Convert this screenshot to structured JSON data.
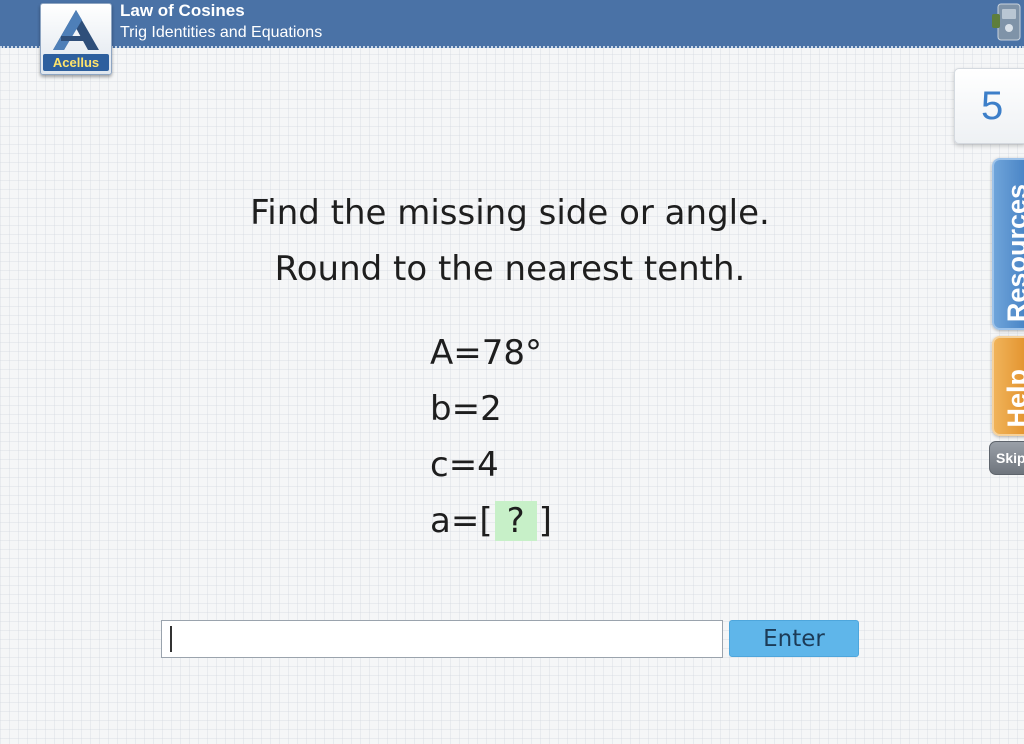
{
  "header": {
    "logo_text": "Acellus",
    "lesson_title": "Law of Cosines",
    "course_subtitle": "Trig Identities and Equations"
  },
  "sidebar": {
    "question_number": "5",
    "resources_label": "Resources",
    "help_label": "Help",
    "skip_label": "Skip"
  },
  "question": {
    "instruction_line1": "Find the missing side or angle.",
    "instruction_line2": "Round to the nearest tenth.",
    "given": [
      {
        "label": "A=78°"
      },
      {
        "label": "b=2"
      },
      {
        "label": "c=4"
      }
    ],
    "unknown_prefix": "a=[",
    "unknown_placeholder": "?",
    "unknown_suffix": "]"
  },
  "answer": {
    "input_value": "",
    "enter_label": "Enter"
  },
  "colors": {
    "header_bg": "#4a72a6",
    "accent_blue": "#3d7fc9",
    "enter_button": "#5fb6ea",
    "help_orange": "#e08c24",
    "unknown_highlight": "#c7f0c8"
  },
  "icons": {
    "logo": "acellus-logo-icon",
    "top_right": "tools-icon"
  }
}
